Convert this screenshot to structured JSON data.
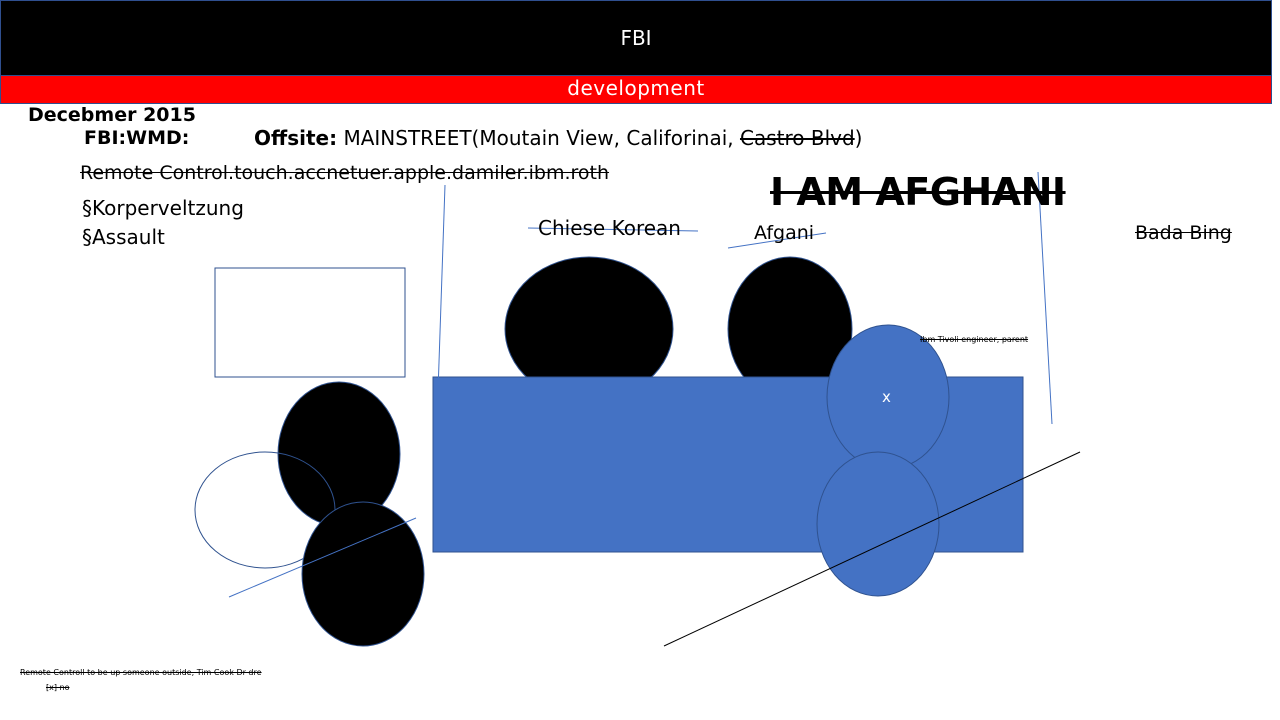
{
  "header": {
    "title": "FBI",
    "subtitle": "development"
  },
  "notes": {
    "date": "Decebmer 2015",
    "wmd_label": "FBI:WMD:",
    "offsite_label": "Offsite:",
    "offsite_value": " MAINSTREET(Moutain View, Califorinai, ",
    "offsite_struck": "Castro Blvd",
    "offsite_close": ")",
    "remote_control": "Remote Control.touch.accnetuer.apple.damiler.ibm.roth",
    "bullet_1": "§Korperveltzung",
    "bullet_2": "§Assault"
  },
  "labels": {
    "i_am_afghani": "I AM AFGHANI",
    "chiese_korean": "Chiese Korean",
    "afgani": "Afgani",
    "bada_bing": "Bada Bing",
    "ibm_tivoli": "Ibm Tivoli engineer, parent",
    "x_mark": "x"
  },
  "footer": {
    "line_1": "Remote Controll to be up someone outside, Tim Cook Dr dre",
    "line_2": "[x] no"
  },
  "colors": {
    "title_bar": "#000000",
    "sub_bar": "#ff0000",
    "shape_blue": "#4472c4",
    "outline_blue": "#2f528f",
    "line_blue": "#4472c4"
  }
}
